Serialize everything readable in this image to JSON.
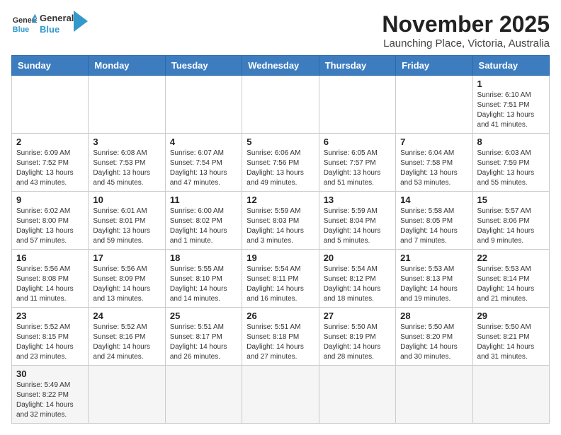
{
  "header": {
    "logo_general": "General",
    "logo_blue": "Blue",
    "month_title": "November 2025",
    "location": "Launching Place, Victoria, Australia"
  },
  "weekdays": [
    "Sunday",
    "Monday",
    "Tuesday",
    "Wednesday",
    "Thursday",
    "Friday",
    "Saturday"
  ],
  "weeks": [
    [
      {
        "day": "",
        "info": ""
      },
      {
        "day": "",
        "info": ""
      },
      {
        "day": "",
        "info": ""
      },
      {
        "day": "",
        "info": ""
      },
      {
        "day": "",
        "info": ""
      },
      {
        "day": "",
        "info": ""
      },
      {
        "day": "1",
        "info": "Sunrise: 6:10 AM\nSunset: 7:51 PM\nDaylight: 13 hours\nand 41 minutes."
      }
    ],
    [
      {
        "day": "2",
        "info": "Sunrise: 6:09 AM\nSunset: 7:52 PM\nDaylight: 13 hours\nand 43 minutes."
      },
      {
        "day": "3",
        "info": "Sunrise: 6:08 AM\nSunset: 7:53 PM\nDaylight: 13 hours\nand 45 minutes."
      },
      {
        "day": "4",
        "info": "Sunrise: 6:07 AM\nSunset: 7:54 PM\nDaylight: 13 hours\nand 47 minutes."
      },
      {
        "day": "5",
        "info": "Sunrise: 6:06 AM\nSunset: 7:56 PM\nDaylight: 13 hours\nand 49 minutes."
      },
      {
        "day": "6",
        "info": "Sunrise: 6:05 AM\nSunset: 7:57 PM\nDaylight: 13 hours\nand 51 minutes."
      },
      {
        "day": "7",
        "info": "Sunrise: 6:04 AM\nSunset: 7:58 PM\nDaylight: 13 hours\nand 53 minutes."
      },
      {
        "day": "8",
        "info": "Sunrise: 6:03 AM\nSunset: 7:59 PM\nDaylight: 13 hours\nand 55 minutes."
      }
    ],
    [
      {
        "day": "9",
        "info": "Sunrise: 6:02 AM\nSunset: 8:00 PM\nDaylight: 13 hours\nand 57 minutes."
      },
      {
        "day": "10",
        "info": "Sunrise: 6:01 AM\nSunset: 8:01 PM\nDaylight: 13 hours\nand 59 minutes."
      },
      {
        "day": "11",
        "info": "Sunrise: 6:00 AM\nSunset: 8:02 PM\nDaylight: 14 hours\nand 1 minute."
      },
      {
        "day": "12",
        "info": "Sunrise: 5:59 AM\nSunset: 8:03 PM\nDaylight: 14 hours\nand 3 minutes."
      },
      {
        "day": "13",
        "info": "Sunrise: 5:59 AM\nSunset: 8:04 PM\nDaylight: 14 hours\nand 5 minutes."
      },
      {
        "day": "14",
        "info": "Sunrise: 5:58 AM\nSunset: 8:05 PM\nDaylight: 14 hours\nand 7 minutes."
      },
      {
        "day": "15",
        "info": "Sunrise: 5:57 AM\nSunset: 8:06 PM\nDaylight: 14 hours\nand 9 minutes."
      }
    ],
    [
      {
        "day": "16",
        "info": "Sunrise: 5:56 AM\nSunset: 8:08 PM\nDaylight: 14 hours\nand 11 minutes."
      },
      {
        "day": "17",
        "info": "Sunrise: 5:56 AM\nSunset: 8:09 PM\nDaylight: 14 hours\nand 13 minutes."
      },
      {
        "day": "18",
        "info": "Sunrise: 5:55 AM\nSunset: 8:10 PM\nDaylight: 14 hours\nand 14 minutes."
      },
      {
        "day": "19",
        "info": "Sunrise: 5:54 AM\nSunset: 8:11 PM\nDaylight: 14 hours\nand 16 minutes."
      },
      {
        "day": "20",
        "info": "Sunrise: 5:54 AM\nSunset: 8:12 PM\nDaylight: 14 hours\nand 18 minutes."
      },
      {
        "day": "21",
        "info": "Sunrise: 5:53 AM\nSunset: 8:13 PM\nDaylight: 14 hours\nand 19 minutes."
      },
      {
        "day": "22",
        "info": "Sunrise: 5:53 AM\nSunset: 8:14 PM\nDaylight: 14 hours\nand 21 minutes."
      }
    ],
    [
      {
        "day": "23",
        "info": "Sunrise: 5:52 AM\nSunset: 8:15 PM\nDaylight: 14 hours\nand 23 minutes."
      },
      {
        "day": "24",
        "info": "Sunrise: 5:52 AM\nSunset: 8:16 PM\nDaylight: 14 hours\nand 24 minutes."
      },
      {
        "day": "25",
        "info": "Sunrise: 5:51 AM\nSunset: 8:17 PM\nDaylight: 14 hours\nand 26 minutes."
      },
      {
        "day": "26",
        "info": "Sunrise: 5:51 AM\nSunset: 8:18 PM\nDaylight: 14 hours\nand 27 minutes."
      },
      {
        "day": "27",
        "info": "Sunrise: 5:50 AM\nSunset: 8:19 PM\nDaylight: 14 hours\nand 28 minutes."
      },
      {
        "day": "28",
        "info": "Sunrise: 5:50 AM\nSunset: 8:20 PM\nDaylight: 14 hours\nand 30 minutes."
      },
      {
        "day": "29",
        "info": "Sunrise: 5:50 AM\nSunset: 8:21 PM\nDaylight: 14 hours\nand 31 minutes."
      }
    ],
    [
      {
        "day": "30",
        "info": "Sunrise: 5:49 AM\nSunset: 8:22 PM\nDaylight: 14 hours\nand 32 minutes."
      },
      {
        "day": "",
        "info": ""
      },
      {
        "day": "",
        "info": ""
      },
      {
        "day": "",
        "info": ""
      },
      {
        "day": "",
        "info": ""
      },
      {
        "day": "",
        "info": ""
      },
      {
        "day": "",
        "info": ""
      }
    ]
  ]
}
